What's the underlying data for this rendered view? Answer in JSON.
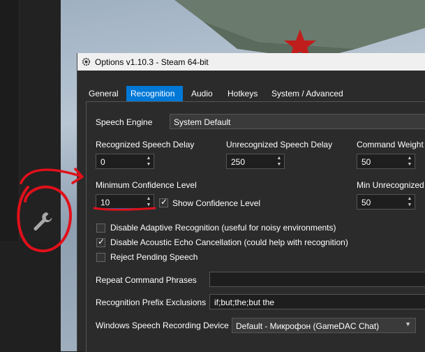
{
  "window": {
    "title": "Options   v1.10.3 - Steam  64-bit"
  },
  "tabs": [
    {
      "label": "General"
    },
    {
      "label": "Recognition",
      "active": true
    },
    {
      "label": "Audio"
    },
    {
      "label": "Hotkeys"
    },
    {
      "label": "System / Advanced"
    }
  ],
  "speech_engine": {
    "label": "Speech Engine",
    "value": "System Default"
  },
  "delays": {
    "recognized_label": "Recognized Speech Delay",
    "recognized_value": "0",
    "unrecognized_label": "Unrecognized Speech Delay",
    "unrecognized_value": "250",
    "command_weight_label": "Command Weight",
    "command_weight_value": "50"
  },
  "confidence": {
    "min_label": "Minimum Confidence Level",
    "min_value": "10",
    "show_label": "Show Confidence Level",
    "show_checked": true,
    "min_unrecognized_label": "Min Unrecognized",
    "min_unrecognized_value": "50"
  },
  "options": {
    "adaptive_label": "Disable Adaptive Recognition (useful for noisy environments)",
    "adaptive_checked": false,
    "echo_label": "Disable Acoustic Echo Cancellation (could help with recognition)",
    "echo_checked": true,
    "reject_label": "Reject Pending Speech",
    "reject_checked": false
  },
  "phrases": {
    "repeat_label": "Repeat Command Phrases",
    "repeat_value": "",
    "prefix_label": "Recognition Prefix Exclusions",
    "prefix_value": "if;but;the;but the"
  },
  "device": {
    "label": "Windows Speech Recording Device",
    "value": "Default - Микрофон (GameDAC Chat)"
  },
  "colors": {
    "accent": "#0078d7",
    "annotation": "#e0101a",
    "window_bg": "#2b2b2b"
  }
}
